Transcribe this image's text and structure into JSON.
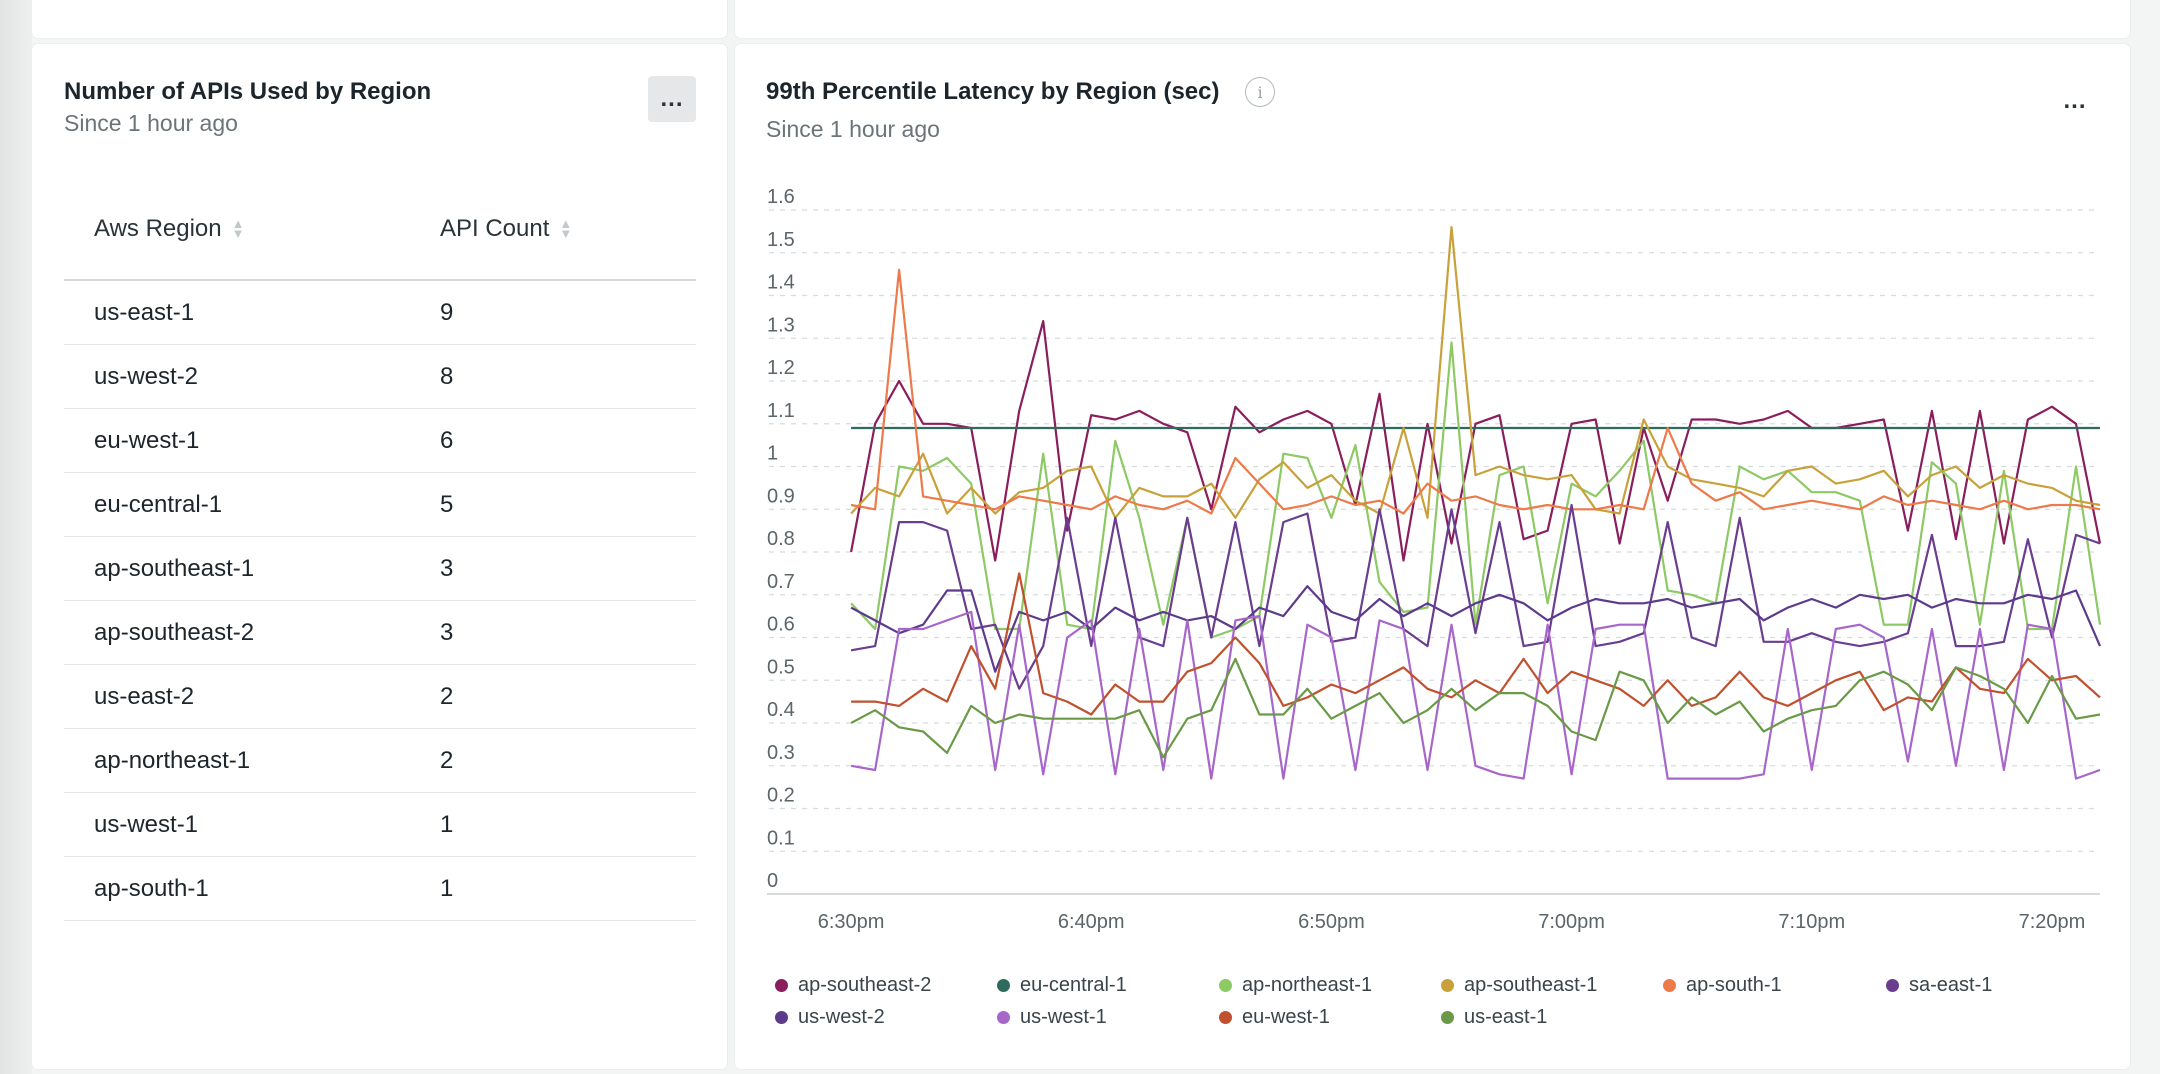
{
  "left_card": {
    "title": "Number of APIs Used by Region",
    "subtitle": "Since 1 hour ago",
    "menu_label": "...",
    "columns": [
      "Aws Region",
      "API Count"
    ],
    "rows": [
      {
        "region": "us-east-1",
        "count": "9"
      },
      {
        "region": "us-west-2",
        "count": "8"
      },
      {
        "region": "eu-west-1",
        "count": "6"
      },
      {
        "region": "eu-central-1",
        "count": "5"
      },
      {
        "region": "ap-southeast-1",
        "count": "3"
      },
      {
        "region": "ap-southeast-2",
        "count": "3"
      },
      {
        "region": "us-east-2",
        "count": "2"
      },
      {
        "region": "ap-northeast-1",
        "count": "2"
      },
      {
        "region": "us-west-1",
        "count": "1"
      },
      {
        "region": "ap-south-1",
        "count": "1"
      }
    ]
  },
  "right_card": {
    "title": "99th Percentile Latency by Region (sec)",
    "subtitle": "Since 1 hour ago",
    "info_label": "i",
    "menu_label": "..."
  },
  "chart_data": {
    "type": "line",
    "title": "99th Percentile Latency by Region (sec)",
    "subtitle": "Since 1 hour ago",
    "xlabel": "",
    "ylabel": "",
    "ylim": [
      0,
      1.6
    ],
    "y_ticks": [
      "0",
      "0.1",
      "0.2",
      "0.3",
      "0.4",
      "0.5",
      "0.6",
      "0.7",
      "0.8",
      "0.9",
      "1",
      "1.1",
      "1.2",
      "1.3",
      "1.4",
      "1.5",
      "1.6"
    ],
    "x_range_minutes": [
      6.5,
      62.0
    ],
    "x_ticks": [
      {
        "minute": 10,
        "label": "6:30pm"
      },
      {
        "minute": 20,
        "label": "6:40pm"
      },
      {
        "minute": 30,
        "label": "6:50pm"
      },
      {
        "minute": 40,
        "label": "7:00pm"
      },
      {
        "minute": 50,
        "label": "7:10pm"
      },
      {
        "minute": 60,
        "label": "7:20pm"
      }
    ],
    "grid": true,
    "legend_position": "bottom",
    "x_minutes": [
      10,
      11,
      12,
      13,
      14,
      15,
      16,
      17,
      18,
      19,
      20,
      21,
      22,
      23,
      24,
      25,
      26,
      27,
      28,
      29,
      30,
      31,
      32,
      33,
      34,
      35,
      36,
      37,
      38,
      39,
      40,
      41,
      42,
      43,
      44,
      45,
      46,
      47,
      48,
      49,
      50,
      51,
      52,
      53,
      54,
      55,
      56,
      57,
      58,
      59,
      60,
      61,
      62
    ],
    "series": [
      {
        "name": "ap-southeast-2",
        "color": "#8a1e5c",
        "values": [
          0.8,
          1.1,
          1.2,
          1.1,
          1.1,
          1.09,
          0.78,
          1.13,
          1.34,
          0.85,
          1.12,
          1.11,
          1.13,
          1.1,
          1.08,
          0.9,
          1.14,
          1.08,
          1.11,
          1.13,
          1.1,
          0.91,
          1.17,
          0.78,
          1.1,
          0.82,
          1.1,
          1.12,
          0.83,
          0.85,
          1.1,
          1.11,
          0.82,
          1.09,
          0.92,
          1.11,
          1.11,
          1.1,
          1.11,
          1.13,
          1.09,
          1.09,
          1.1,
          1.11,
          0.85,
          1.13,
          0.83,
          1.13,
          0.82,
          1.11,
          1.14,
          1.1,
          0.82
        ]
      },
      {
        "name": "eu-central-1",
        "color": "#2e6b5e",
        "values": [
          1.09,
          1.09,
          1.09,
          1.09,
          1.09,
          1.09,
          1.09,
          1.09,
          1.09,
          1.09,
          1.09,
          1.09,
          1.09,
          1.09,
          1.09,
          1.09,
          1.09,
          1.09,
          1.09,
          1.09,
          1.09,
          1.09,
          1.09,
          1.09,
          1.09,
          1.09,
          1.09,
          1.09,
          1.09,
          1.09,
          1.09,
          1.09,
          1.09,
          1.09,
          1.09,
          1.09,
          1.09,
          1.09,
          1.09,
          1.09,
          1.09,
          1.09,
          1.09,
          1.09,
          1.09,
          1.09,
          1.09,
          1.09,
          1.09,
          1.09,
          1.09,
          1.09,
          1.09
        ]
      },
      {
        "name": "ap-northeast-1",
        "color": "#8dc965",
        "values": [
          0.68,
          0.62,
          1.0,
          0.99,
          1.02,
          0.96,
          0.62,
          0.62,
          1.03,
          0.63,
          0.62,
          1.06,
          0.88,
          0.63,
          0.88,
          0.6,
          0.62,
          0.65,
          1.03,
          1.02,
          0.88,
          1.05,
          0.73,
          0.66,
          0.67,
          1.29,
          0.63,
          0.98,
          1.0,
          0.68,
          0.96,
          0.93,
          0.99,
          1.06,
          0.71,
          0.7,
          0.68,
          1.0,
          0.97,
          0.99,
          0.94,
          0.94,
          0.92,
          0.63,
          0.63,
          1.01,
          0.96,
          0.63,
          0.99,
          0.62,
          0.62,
          1.0,
          0.63
        ]
      },
      {
        "name": "ap-southeast-1",
        "color": "#c9a13a",
        "values": [
          0.89,
          0.95,
          0.93,
          1.03,
          0.89,
          0.95,
          0.89,
          0.94,
          0.95,
          0.99,
          1.0,
          0.88,
          0.95,
          0.93,
          0.93,
          0.96,
          0.88,
          0.97,
          1.01,
          0.95,
          0.98,
          0.92,
          0.89,
          1.09,
          0.88,
          1.56,
          0.98,
          1.0,
          0.98,
          0.97,
          0.98,
          0.9,
          0.89,
          1.11,
          1.0,
          0.97,
          0.96,
          0.95,
          0.93,
          0.99,
          1.0,
          0.96,
          0.97,
          0.99,
          0.93,
          0.98,
          1.0,
          0.95,
          0.98,
          0.96,
          0.95,
          0.92,
          0.91
        ]
      },
      {
        "name": "ap-south-1",
        "color": "#ec7a4a",
        "values": [
          0.91,
          0.9,
          1.46,
          0.93,
          0.92,
          0.91,
          0.9,
          0.93,
          0.92,
          0.91,
          0.9,
          0.93,
          0.91,
          0.9,
          0.92,
          0.89,
          1.02,
          0.96,
          0.9,
          0.91,
          0.93,
          0.91,
          0.92,
          0.89,
          0.96,
          0.92,
          0.93,
          0.91,
          0.9,
          0.91,
          0.9,
          0.9,
          0.91,
          0.9,
          1.09,
          0.96,
          0.92,
          0.94,
          0.9,
          0.91,
          0.92,
          0.91,
          0.9,
          0.93,
          0.91,
          0.92,
          0.91,
          0.9,
          0.92,
          0.9,
          0.91,
          0.91,
          0.9
        ]
      },
      {
        "name": "sa-east-1",
        "color": "#6a3d8f",
        "values": [
          0.57,
          0.58,
          0.87,
          0.87,
          0.85,
          0.62,
          0.63,
          0.48,
          0.58,
          0.88,
          0.58,
          0.88,
          0.6,
          0.58,
          0.88,
          0.6,
          0.87,
          0.58,
          0.87,
          0.89,
          0.59,
          0.6,
          0.9,
          0.62,
          0.58,
          0.9,
          0.61,
          0.87,
          0.58,
          0.59,
          0.91,
          0.58,
          0.59,
          0.61,
          0.87,
          0.6,
          0.58,
          0.88,
          0.59,
          0.59,
          0.61,
          0.59,
          0.58,
          0.59,
          0.61,
          0.84,
          0.58,
          0.58,
          0.59,
          0.83,
          0.6,
          0.84,
          0.82
        ]
      },
      {
        "name": "us-west-2",
        "color": "#5c3a8c",
        "values": [
          0.67,
          0.64,
          0.61,
          0.63,
          0.71,
          0.71,
          0.52,
          0.66,
          0.64,
          0.66,
          0.62,
          0.67,
          0.64,
          0.66,
          0.64,
          0.65,
          0.62,
          0.67,
          0.65,
          0.72,
          0.66,
          0.64,
          0.69,
          0.65,
          0.68,
          0.65,
          0.68,
          0.7,
          0.68,
          0.64,
          0.67,
          0.69,
          0.68,
          0.68,
          0.69,
          0.67,
          0.68,
          0.69,
          0.64,
          0.67,
          0.69,
          0.67,
          0.7,
          0.69,
          0.7,
          0.67,
          0.69,
          0.68,
          0.68,
          0.7,
          0.69,
          0.71,
          0.58
        ]
      },
      {
        "name": "us-west-1",
        "color": "#a766c9",
        "values": [
          0.3,
          0.29,
          0.62,
          0.62,
          0.64,
          0.66,
          0.29,
          0.63,
          0.28,
          0.6,
          0.64,
          0.28,
          0.62,
          0.29,
          0.64,
          0.27,
          0.64,
          0.65,
          0.27,
          0.63,
          0.6,
          0.29,
          0.64,
          0.62,
          0.29,
          0.63,
          0.3,
          0.28,
          0.27,
          0.63,
          0.28,
          0.62,
          0.63,
          0.63,
          0.27,
          0.27,
          0.27,
          0.27,
          0.28,
          0.62,
          0.29,
          0.62,
          0.63,
          0.6,
          0.31,
          0.62,
          0.3,
          0.62,
          0.29,
          0.63,
          0.62,
          0.27,
          0.29
        ]
      },
      {
        "name": "eu-west-1",
        "color": "#c0512e",
        "values": [
          0.45,
          0.45,
          0.44,
          0.48,
          0.45,
          0.58,
          0.48,
          0.75,
          0.47,
          0.45,
          0.42,
          0.49,
          0.45,
          0.45,
          0.52,
          0.54,
          0.6,
          0.54,
          0.44,
          0.46,
          0.49,
          0.47,
          0.5,
          0.53,
          0.48,
          0.46,
          0.5,
          0.47,
          0.55,
          0.47,
          0.52,
          0.5,
          0.48,
          0.44,
          0.5,
          0.44,
          0.46,
          0.52,
          0.46,
          0.44,
          0.47,
          0.5,
          0.52,
          0.43,
          0.46,
          0.45,
          0.53,
          0.48,
          0.47,
          0.55,
          0.5,
          0.51,
          0.46
        ]
      },
      {
        "name": "us-east-1",
        "color": "#6a9a48",
        "values": [
          0.4,
          0.43,
          0.39,
          0.38,
          0.33,
          0.44,
          0.4,
          0.42,
          0.41,
          0.41,
          0.41,
          0.41,
          0.43,
          0.32,
          0.41,
          0.43,
          0.55,
          0.42,
          0.42,
          0.48,
          0.41,
          0.44,
          0.47,
          0.4,
          0.43,
          0.48,
          0.43,
          0.47,
          0.47,
          0.44,
          0.38,
          0.36,
          0.52,
          0.5,
          0.4,
          0.46,
          0.42,
          0.45,
          0.38,
          0.41,
          0.43,
          0.44,
          0.5,
          0.52,
          0.49,
          0.43,
          0.53,
          0.51,
          0.48,
          0.4,
          0.51,
          0.41,
          0.42
        ]
      }
    ]
  }
}
